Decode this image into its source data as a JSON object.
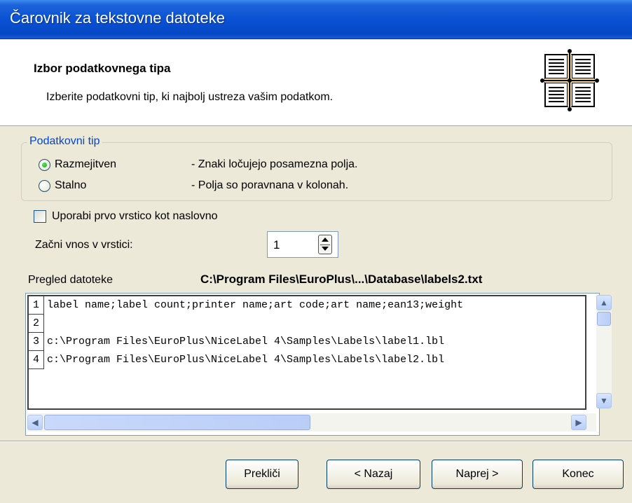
{
  "window": {
    "title": "Čarovnik za tekstovne datoteke"
  },
  "header": {
    "title": "Izbor podatkovnega tipa",
    "subtitle": "Izberite podatkovni tip, ki najbolj ustreza vašim podatkom.",
    "icon": "table-columns-icon"
  },
  "datatype_group": {
    "legend": "Podatkovni tip",
    "options": [
      {
        "label": "Razmejitven",
        "description": "- Znaki ločujejo posamezna polja.",
        "checked": true
      },
      {
        "label": "Stalno",
        "description": "- Polja so poravnana v kolonah.",
        "checked": false
      }
    ]
  },
  "first_row_header": {
    "label": "Uporabi prvo vrstico kot naslovno",
    "checked": false
  },
  "start_row": {
    "label": "Začni vnos v vrstici:",
    "value": "1"
  },
  "preview": {
    "label": "Pregled datoteke",
    "path": "C:\\Program Files\\EuroPlus\\...\\Database\\labels2.txt",
    "lines": [
      {
        "num": "1",
        "text": "label name;label count;printer name;art code;art name;ean13;weight"
      },
      {
        "num": "2",
        "text": ""
      },
      {
        "num": "3",
        "text": "c:\\Program Files\\EuroPlus\\NiceLabel 4\\Samples\\Labels\\label1.lbl"
      },
      {
        "num": "4",
        "text": "c:\\Program Files\\EuroPlus\\NiceLabel 4\\Samples\\Labels\\label2.lbl"
      }
    ]
  },
  "buttons": {
    "cancel": "Prekliči",
    "back": "< Nazaj",
    "next": "Naprej >",
    "finish": "Konec"
  }
}
